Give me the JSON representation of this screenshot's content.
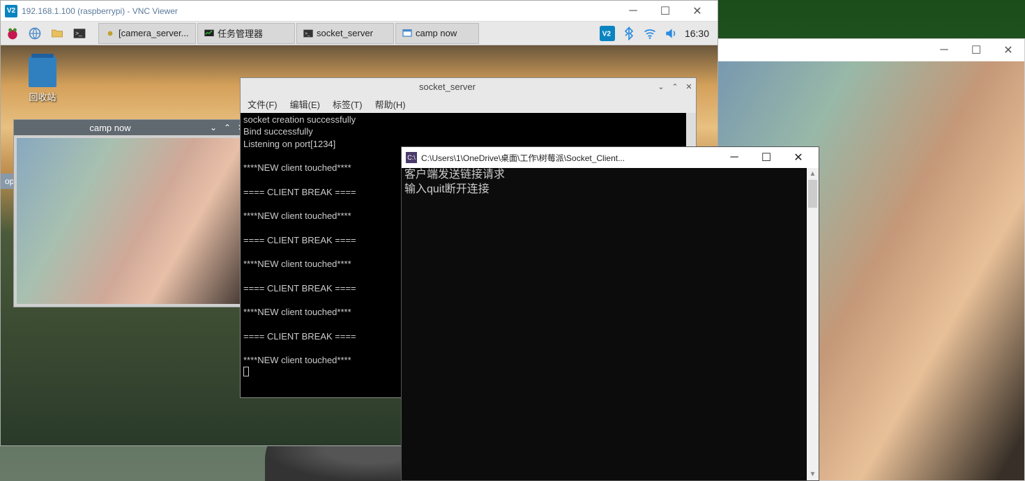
{
  "vnc": {
    "title": "192.168.1.100 (raspberrypi) - VNC Viewer",
    "logo": "V2"
  },
  "pi": {
    "taskbar": {
      "apps": [
        {
          "icon": "camera",
          "label": "[camera_server..."
        },
        {
          "icon": "monitor",
          "label": "任务管理器"
        },
        {
          "icon": "terminal",
          "label": "socket_server"
        },
        {
          "icon": "window",
          "label": "camp now"
        }
      ],
      "clock": "16:30"
    },
    "trash_label": "回收站",
    "side_tag": "op"
  },
  "camp": {
    "title": "camp now"
  },
  "terminal": {
    "title": "socket_server",
    "menu": [
      "文件(F)",
      "编辑(E)",
      "标签(T)",
      "帮助(H)"
    ],
    "lines": "socket creation successfully\nBind successfully\nListening on port[1234]\n\n****NEW client touched****\n\n==== CLIENT BREAK ====\n\n****NEW client touched****\n\n==== CLIENT BREAK ====\n\n****NEW client touched****\n\n==== CLIENT BREAK ====\n\n****NEW client touched****\n\n==== CLIENT BREAK ====\n\n****NEW client touched****"
  },
  "cmd": {
    "title": "C:\\Users\\1\\OneDrive\\桌面\\工作\\树莓派\\Socket_Client...",
    "logo": "C:\\",
    "line1": "客户端发送链接请求",
    "line2": "输入quit断开连接"
  }
}
